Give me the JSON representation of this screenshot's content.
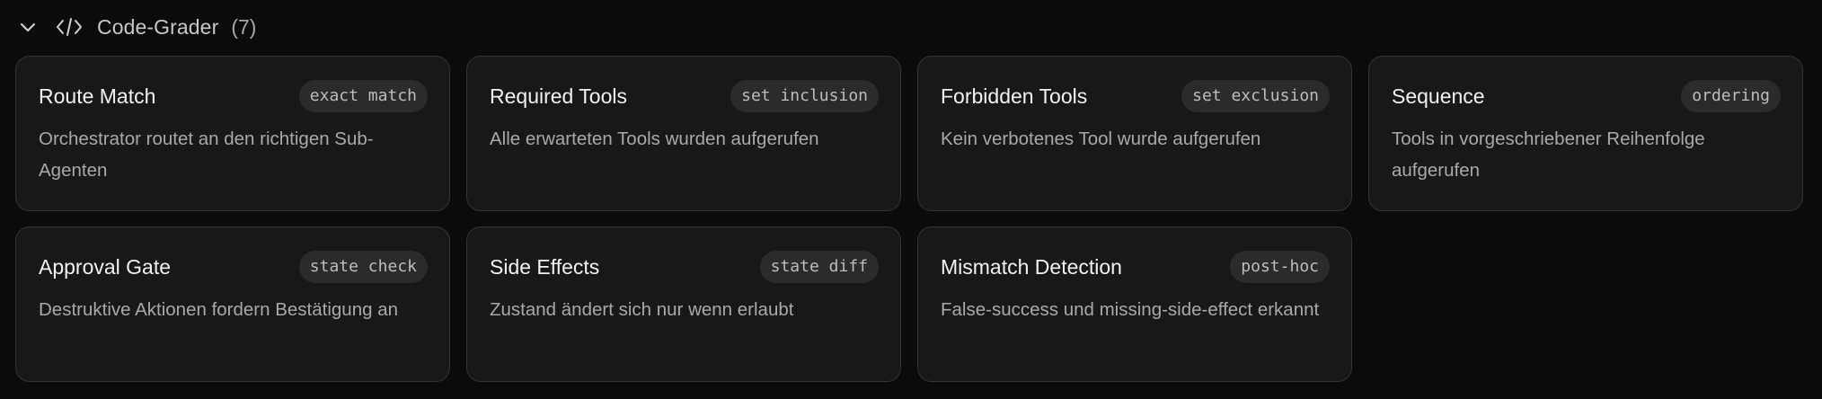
{
  "section": {
    "title": "Code-Grader",
    "count": "(7)",
    "chevron_icon": "chevron-down-icon",
    "code_icon": "code-icon"
  },
  "cards": [
    {
      "title": "Route Match",
      "badge": "exact match",
      "description": "Orchestrator routet an den richtigen Sub-Agenten"
    },
    {
      "title": "Required Tools",
      "badge": "set inclusion",
      "description": "Alle erwarteten Tools wurden aufgerufen"
    },
    {
      "title": "Forbidden Tools",
      "badge": "set exclusion",
      "description": "Kein verbotenes Tool wurde aufgerufen"
    },
    {
      "title": "Sequence",
      "badge": "ordering",
      "description": "Tools in vorgeschriebener Reihenfolge aufgerufen"
    },
    {
      "title": "Approval Gate",
      "badge": "state check",
      "description": "Destruktive Aktionen fordern Bestätigung an"
    },
    {
      "title": "Side Effects",
      "badge": "state diff",
      "description": "Zustand ändert sich nur wenn erlaubt"
    },
    {
      "title": "Mismatch Detection",
      "badge": "post-hoc",
      "description": "False-success und missing-side-effect erkannt"
    }
  ]
}
